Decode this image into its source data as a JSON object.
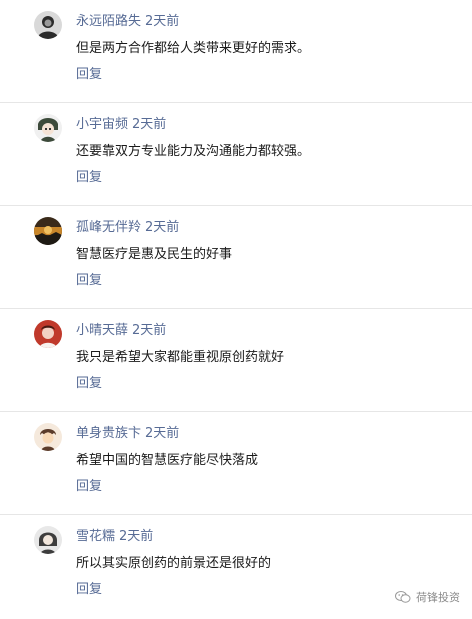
{
  "comments": [
    {
      "username": "永远陌路失",
      "time": "2天前",
      "content": "但是两方合作都给人类带来更好的需求。",
      "reply_label": "回复",
      "avatar_icon": "avatar-dark-portrait",
      "avatar_colors": [
        "#2b2b2b",
        "#d9d9d9"
      ]
    },
    {
      "username": "小宇宙频",
      "time": "2天前",
      "content": "还要靠双方专业能力及沟通能力都较强。",
      "reply_label": "回复",
      "avatar_icon": "avatar-anime-character",
      "avatar_colors": [
        "#3c4a3a",
        "#f0f0f0"
      ]
    },
    {
      "username": "孤峰无伴羚",
      "time": "2天前",
      "content": "智慧医疗是惠及民生的好事",
      "reply_label": "回复",
      "avatar_icon": "avatar-sunset-landscape",
      "avatar_colors": [
        "#3a2a1a",
        "#c8862a"
      ]
    },
    {
      "username": "小晴天薛",
      "time": "2天前",
      "content": "我只是希望大家都能重视原创药就好",
      "reply_label": "回复",
      "avatar_icon": "avatar-red-portrait",
      "avatar_colors": [
        "#c0392b",
        "#f3d1c4"
      ]
    },
    {
      "username": "单身贵族卞",
      "time": "2天前",
      "content": "希望中国的智慧医疗能尽快落成",
      "reply_label": "回复",
      "avatar_icon": "avatar-cartoon-character",
      "avatar_colors": [
        "#5a3b2a",
        "#f5e9dc"
      ]
    },
    {
      "username": "雪花糯",
      "time": "2天前",
      "content": "所以其实原创药的前景还是很好的",
      "reply_label": "回复",
      "avatar_icon": "avatar-grey-portrait",
      "avatar_colors": [
        "#3d3d3d",
        "#e8e8e8"
      ]
    }
  ],
  "watermark": {
    "text": "荷锋投资",
    "icon": "wechat-icon"
  },
  "colors": {
    "link": "#576b95",
    "text": "#1a1a1a",
    "divider": "#e6e6e6"
  }
}
